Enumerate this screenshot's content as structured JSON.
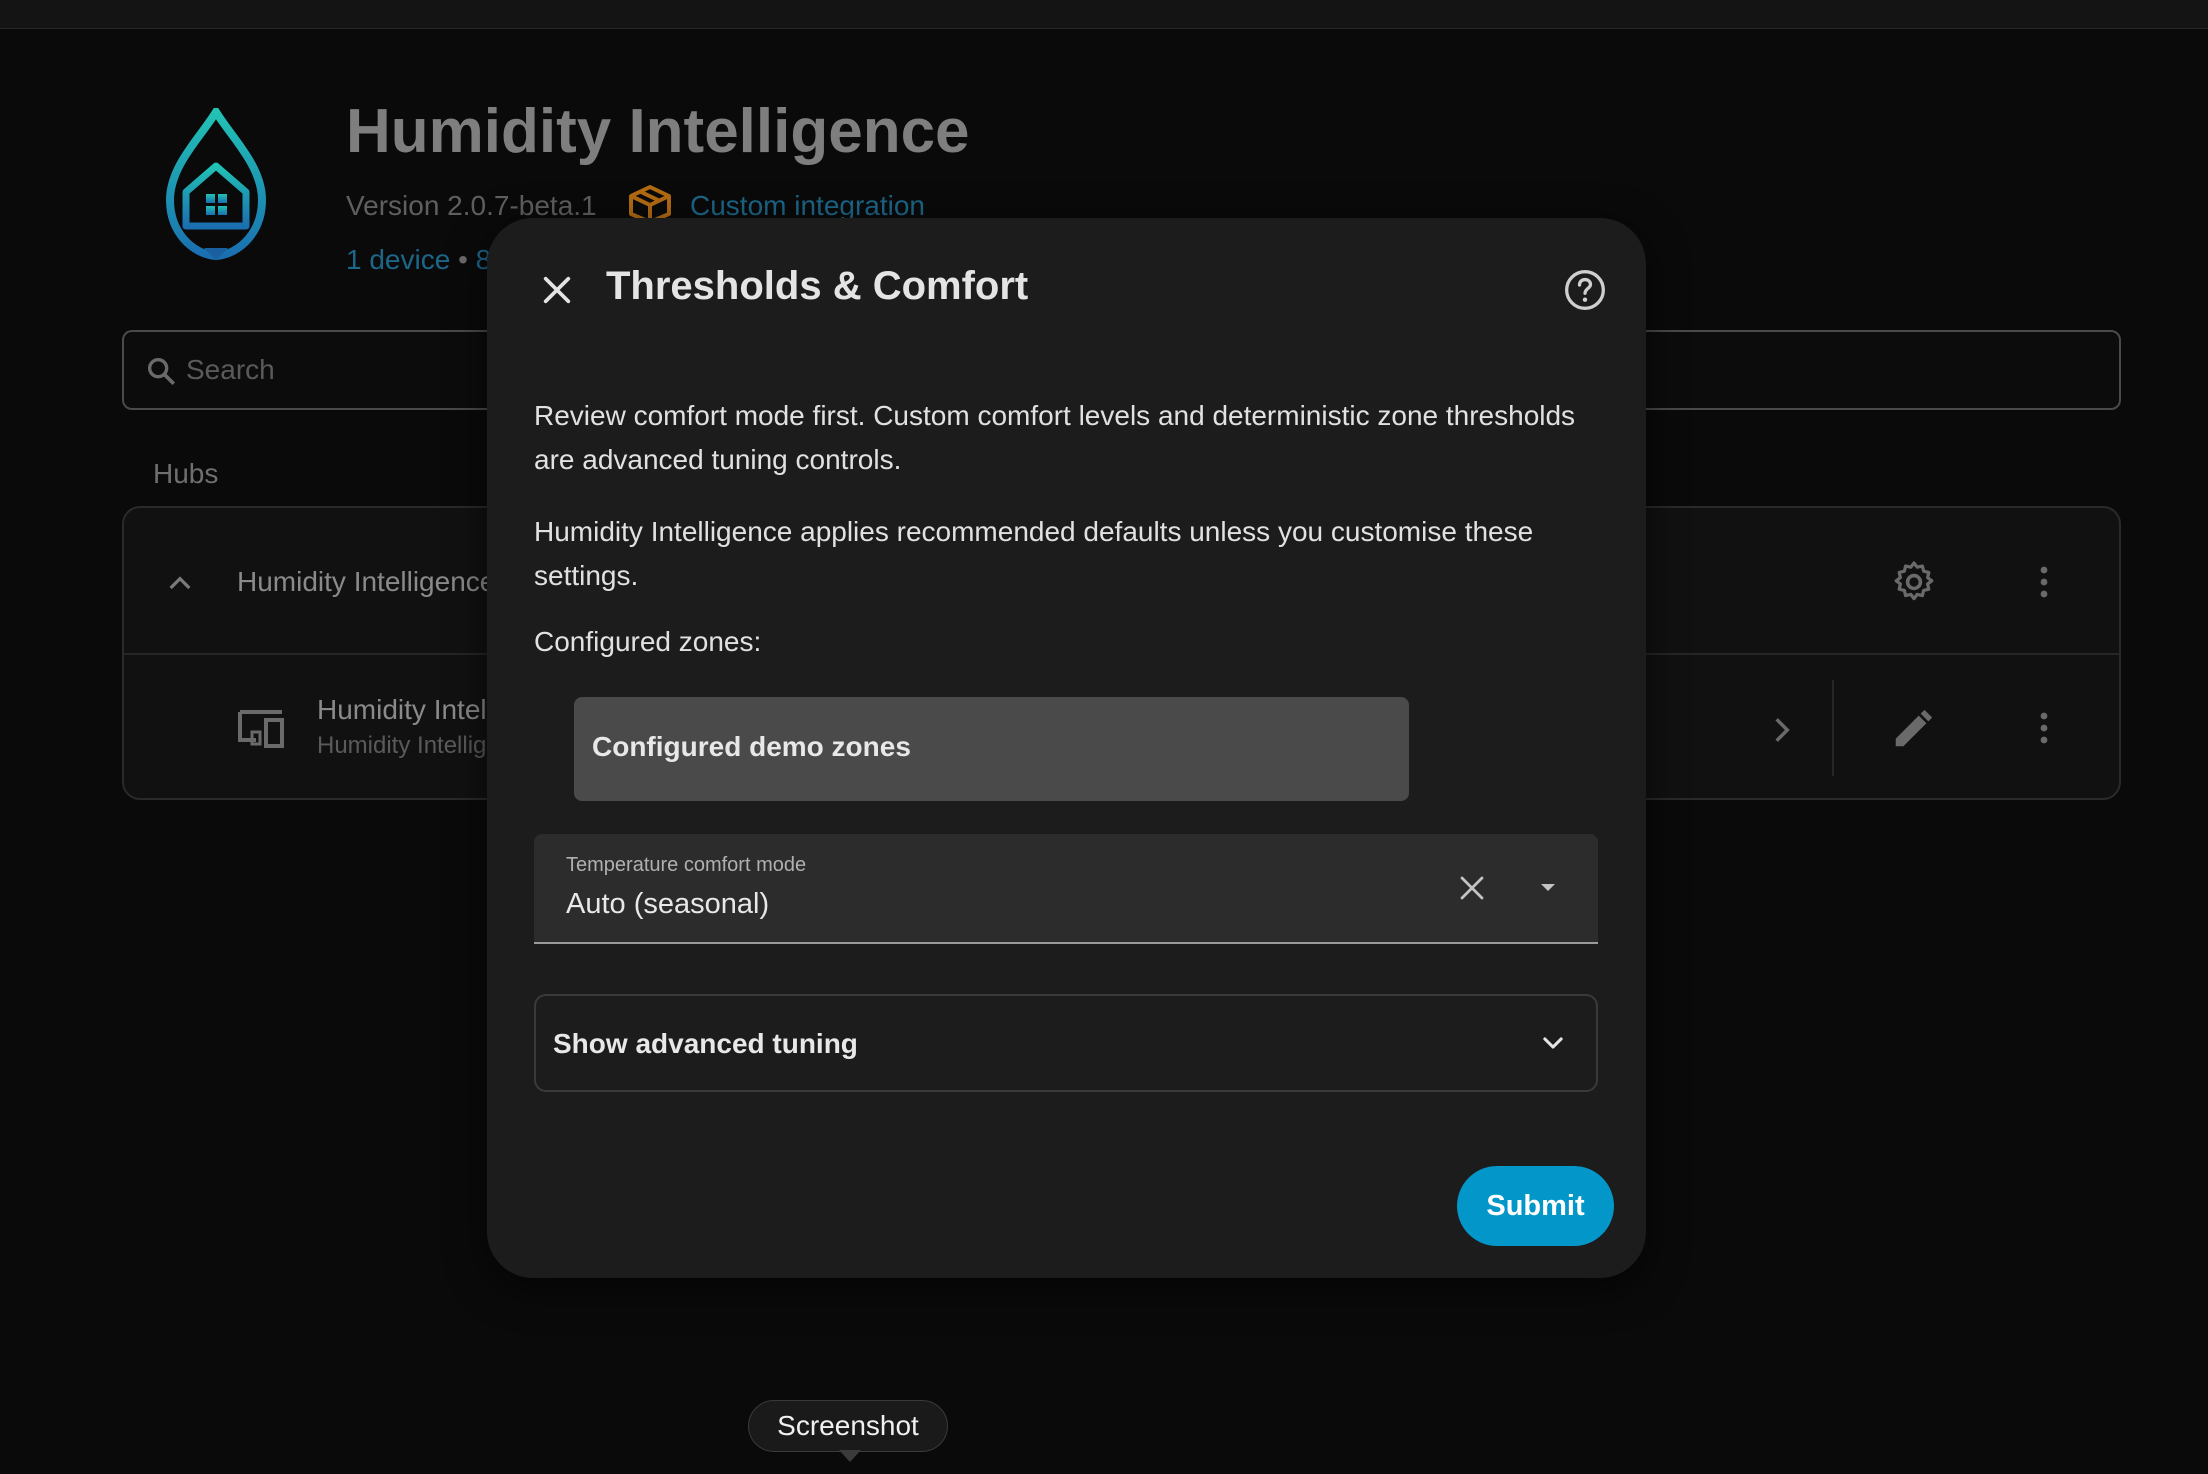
{
  "integration": {
    "title": "Humidity Intelligence",
    "version": "Version 2.0.7-beta.1",
    "custom_label": "Custom integration",
    "devices_summary": "1 device",
    "devices_separator": " • ",
    "entities_partial": "8"
  },
  "search": {
    "placeholder": "Search"
  },
  "hubs": {
    "heading": "Hubs",
    "hub_name": "Humidity Intelligence",
    "device_name": "Humidity Intel",
    "device_subtitle": "Humidity Intellig"
  },
  "dialog": {
    "title": "Thresholds & Comfort",
    "intro": "Review comfort mode first. Custom comfort levels and deterministic zone thresholds are advanced tuning controls.",
    "defaults_note": "Humidity Intelligence applies recommended defaults unless you customise these settings.",
    "zones_label": "Configured zones:",
    "zones_value": "Configured demo zones",
    "comfort_mode": {
      "label": "Temperature comfort mode",
      "value": "Auto (seasonal)"
    },
    "advanced_label": "Show advanced tuning",
    "submit_label": "Submit"
  },
  "tooltip": {
    "text": "Screenshot"
  },
  "colors": {
    "accent": "#0396c8",
    "link": "#1c6688",
    "dialog_bg": "#1c1c1c",
    "page_bg": "#0a0a0a"
  }
}
